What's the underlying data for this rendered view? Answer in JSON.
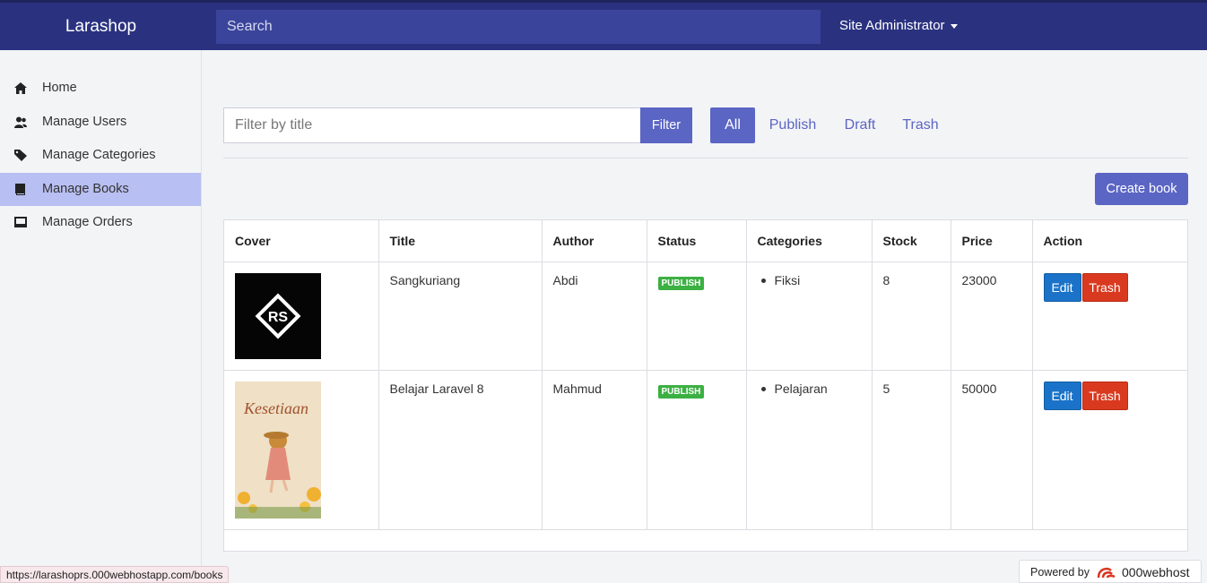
{
  "header": {
    "brand": "Larashop",
    "search_placeholder": "Search",
    "user": "Site Administrator"
  },
  "sidebar": {
    "items": [
      {
        "label": "Home",
        "icon": "home-icon"
      },
      {
        "label": "Manage Users",
        "icon": "users-icon"
      },
      {
        "label": "Manage Categories",
        "icon": "tag-icon"
      },
      {
        "label": "Manage Books",
        "icon": "book-icon",
        "active": true
      },
      {
        "label": "Manage Orders",
        "icon": "inbox-icon"
      }
    ]
  },
  "filter": {
    "placeholder": "Filter by title",
    "button": "Filter"
  },
  "tabs": [
    "All",
    "Publish",
    "Draft",
    "Trash"
  ],
  "create_button": "Create book",
  "table": {
    "headers": [
      "Cover",
      "Title",
      "Author",
      "Status",
      "Categories",
      "Stock",
      "Price",
      "Action"
    ],
    "rows": [
      {
        "title": "Sangkuriang",
        "author": "Abdi",
        "status": "PUBLISH",
        "categories": [
          "Fiksi"
        ],
        "stock": "8",
        "price": "23000",
        "cover_text": "RS"
      },
      {
        "title": "Belajar Laravel 8",
        "author": "Mahmud",
        "status": "PUBLISH",
        "categories": [
          "Pelajaran"
        ],
        "stock": "5",
        "price": "50000",
        "cover_text": "Kesetiaan"
      }
    ],
    "edit_label": "Edit",
    "trash_label": "Trash"
  },
  "status_url": "https://larashoprs.000webhostapp.com/books",
  "powered": {
    "label": "Powered by",
    "brand": "000webhost"
  }
}
